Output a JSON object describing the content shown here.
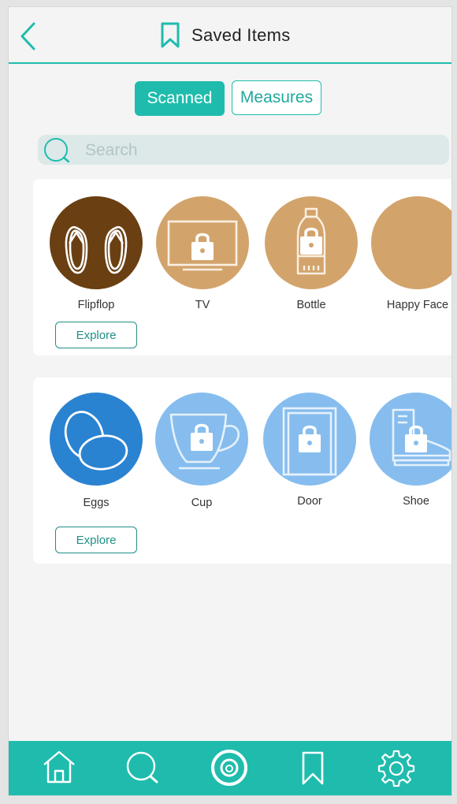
{
  "header": {
    "title": "Saved Items",
    "back_icon": "chevron-left-icon",
    "title_icon": "bookmark-icon"
  },
  "segments": {
    "scanned": "Scanned",
    "measures": "Measures",
    "active": "Scanned"
  },
  "search": {
    "placeholder": "Search",
    "value": ""
  },
  "colors": {
    "accent": "#1fbcad",
    "brown_dark": "#6a3f12",
    "tan": "#d2a46c",
    "blue_dark": "#2a83d0",
    "blue_light": "#86bdee"
  },
  "groups": [
    {
      "items": [
        {
          "label": "Flipflop",
          "icon": "flipflop-icon",
          "locked": false
        },
        {
          "label": "TV",
          "icon": "tv-icon",
          "locked": true
        },
        {
          "label": "Bottle",
          "icon": "bottle-icon",
          "locked": true
        },
        {
          "label": "Happy Face",
          "icon": "happy-face-icon",
          "locked": true
        }
      ],
      "explore_label": "Explore"
    },
    {
      "items": [
        {
          "label": "Eggs",
          "icon": "eggs-icon",
          "locked": false
        },
        {
          "label": "Cup",
          "icon": "cup-icon",
          "locked": true
        },
        {
          "label": "Door",
          "icon": "door-icon",
          "locked": true
        },
        {
          "label": "Shoe",
          "icon": "shoe-icon",
          "locked": true
        }
      ],
      "explore_label": "Explore"
    }
  ],
  "tabbar": [
    "home-icon",
    "search-icon",
    "camera-icon",
    "bookmark-icon",
    "settings-icon"
  ]
}
